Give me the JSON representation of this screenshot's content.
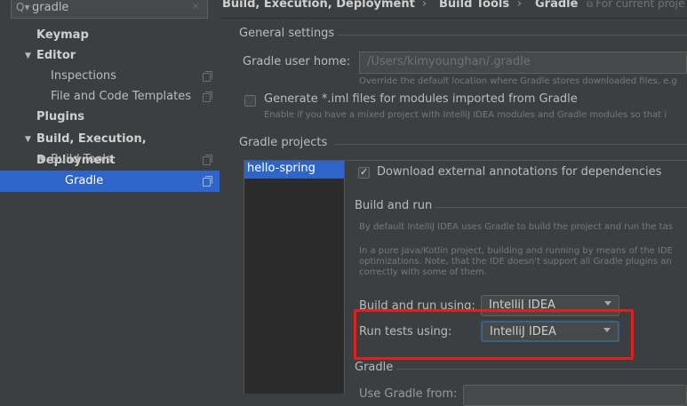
{
  "search": {
    "value": "gradle",
    "clear_glyph": "×"
  },
  "sidebar": {
    "items": [
      {
        "label": "Keymap"
      },
      {
        "label": "Editor"
      },
      {
        "label": "Inspections"
      },
      {
        "label": "File and Code Templates"
      },
      {
        "label": "Plugins"
      },
      {
        "label": "Build, Execution, Deployment"
      },
      {
        "label": "Build Tools"
      },
      {
        "label": "Gradle"
      }
    ]
  },
  "header": {
    "crumb1": "Build, Execution, Deployment",
    "sep1": "›",
    "crumb2": "Build Tools",
    "sep2": "›",
    "crumb3": "Gradle",
    "note": "For current proje"
  },
  "general": {
    "title": "General settings",
    "user_home_label": "Gradle user home:",
    "user_home_placeholder": "/Users/kimyounghan/.gradle",
    "user_home_hint": "Override the default location where Gradle stores downloaded files, e.g",
    "generate_iml_label": "Generate *.iml files for modules imported from Gradle",
    "generate_iml_hint": "Enable if you have a mixed project with IntelliJ IDEA modules and Gradle modules so that i"
  },
  "projects": {
    "title": "Gradle projects",
    "items": [
      "hello-spring"
    ],
    "download_annotations_label": "Download external annotations for dependencies"
  },
  "build_run": {
    "title": "Build and run",
    "desc1": "By default IntelliJ IDEA uses Gradle to build the project and run the tas",
    "desc2_line1": "In a pure Java/Kotlin project, building and running by means of the IDE",
    "desc2_line2": "optimizations. Note, that the IDE doesn't support all Gradle plugins an",
    "desc2_line3": "correctly with some of them.",
    "build_using_label": "Build and run using:",
    "build_using_value": "IntelliJ IDEA",
    "tests_using_label": "Run tests using:",
    "tests_using_value": "IntelliJ IDEA"
  },
  "gradle_section": {
    "title": "Gradle",
    "partial_label": "Use Gradle from:"
  },
  "colors": {
    "selection": "#2f65ca",
    "highlight_box": "#e01f1f",
    "background": "#3c3f41"
  }
}
